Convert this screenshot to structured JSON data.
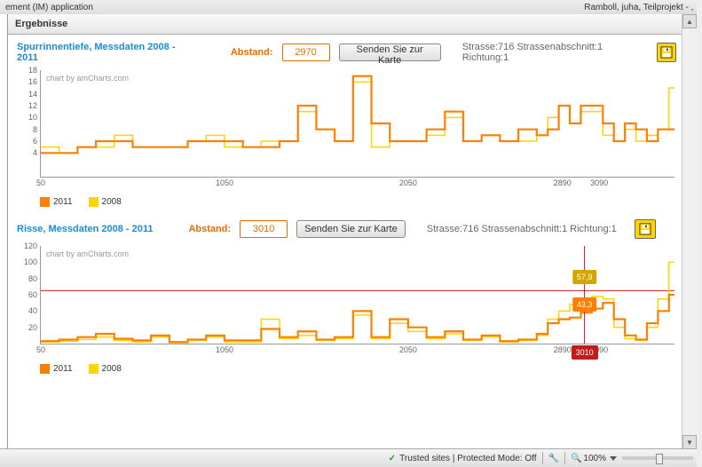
{
  "header": {
    "title_left": "ement (IM) application",
    "title_right": "Ramboll, juha, Teilprojekt - , ."
  },
  "results": {
    "heading": "Ergebnisse"
  },
  "charts": [
    {
      "title": "Spurrinnentiefe, Messdaten 2008 - 2011",
      "abstand_label": "Abstand:",
      "abstand_value": "2970",
      "send_label": "Senden Sie zur Karte",
      "meta": "Strasse:716 Strassenabschnitt:1 Richtung:1",
      "watermark": "chart by amCharts.com"
    },
    {
      "title": "Risse, Messdaten 2008 - 2011",
      "abstand_label": "Abstand:",
      "abstand_value": "3010",
      "send_label": "Senden Sie zur Karte",
      "meta": "Strasse:716 Strassenabschnitt:1 Richtung:1",
      "watermark": "chart by amCharts.com",
      "cursor": {
        "x": 3010,
        "label_axis": "3010",
        "label_2008": "57,9",
        "label_2011": "43,3"
      }
    }
  ],
  "legend": {
    "s1": "2011",
    "s2": "2008"
  },
  "status": {
    "trusted": "Trusted sites | Protected Mode: Off",
    "zoom": "100%"
  },
  "chart_data": [
    {
      "id": "spurrinnentiefe",
      "title": "Spurrinnentiefe, Messdaten 2008 - 2011",
      "type": "line-step",
      "xlabel": "",
      "ylabel": "",
      "ylim": [
        0,
        18
      ],
      "xlim": [
        50,
        3500
      ],
      "x_ticks": [
        50,
        1050,
        2050,
        2890,
        3090
      ],
      "y_ticks": [
        4,
        6,
        8,
        10,
        12,
        14,
        16,
        18
      ],
      "series": [
        {
          "name": "2011",
          "color": "#ff7f00",
          "x": [
            50,
            150,
            250,
            350,
            450,
            550,
            650,
            750,
            850,
            950,
            1050,
            1150,
            1250,
            1350,
            1450,
            1550,
            1650,
            1750,
            1850,
            1950,
            2050,
            2150,
            2250,
            2350,
            2450,
            2550,
            2650,
            2750,
            2810,
            2870,
            2930,
            2990,
            3050,
            3110,
            3170,
            3230,
            3290,
            3350,
            3410,
            3470
          ],
          "values": [
            4,
            4,
            5,
            6,
            6,
            5,
            5,
            5,
            6,
            6,
            6,
            5,
            5,
            6,
            12,
            8,
            6,
            17,
            9,
            6,
            6,
            8,
            11,
            6,
            7,
            6,
            8,
            7,
            8,
            12,
            9,
            12,
            12,
            9,
            6,
            9,
            8,
            6,
            8,
            8
          ]
        },
        {
          "name": "2008",
          "color": "#ffd400",
          "x": [
            50,
            150,
            250,
            350,
            450,
            550,
            650,
            750,
            850,
            950,
            1050,
            1150,
            1250,
            1350,
            1450,
            1550,
            1650,
            1750,
            1850,
            1950,
            2050,
            2150,
            2250,
            2350,
            2450,
            2550,
            2650,
            2750,
            2810,
            2870,
            2930,
            2990,
            3050,
            3110,
            3170,
            3230,
            3290,
            3350,
            3410,
            3470
          ],
          "values": [
            5,
            4,
            5,
            5,
            7,
            5,
            5,
            5,
            6,
            7,
            5,
            5,
            6,
            6,
            11,
            8,
            6,
            16,
            5,
            6,
            6,
            7,
            10,
            6,
            7,
            6,
            6,
            7,
            10,
            12,
            9,
            11,
            11,
            7,
            6,
            8,
            6,
            7,
            8,
            15
          ]
        }
      ]
    },
    {
      "id": "risse",
      "title": "Risse, Messdaten 2008 - 2011",
      "type": "line-step",
      "xlabel": "",
      "ylabel": "",
      "ylim": [
        0,
        120
      ],
      "xlim": [
        50,
        3500
      ],
      "threshold": 65,
      "x_ticks": [
        50,
        1050,
        2050,
        2890,
        3090
      ],
      "y_ticks": [
        20,
        40,
        60,
        80,
        100,
        120
      ],
      "series": [
        {
          "name": "2011",
          "color": "#ff7f00",
          "x": [
            50,
            150,
            250,
            350,
            450,
            550,
            650,
            750,
            850,
            950,
            1050,
            1150,
            1250,
            1350,
            1450,
            1550,
            1650,
            1750,
            1850,
            1950,
            2050,
            2150,
            2250,
            2350,
            2450,
            2550,
            2650,
            2750,
            2810,
            2870,
            2930,
            2990,
            3050,
            3110,
            3170,
            3230,
            3290,
            3350,
            3410,
            3470
          ],
          "values": [
            3,
            5,
            8,
            12,
            6,
            4,
            10,
            2,
            5,
            10,
            4,
            4,
            18,
            8,
            15,
            5,
            8,
            40,
            8,
            30,
            20,
            8,
            15,
            5,
            10,
            3,
            5,
            12,
            25,
            30,
            32,
            38,
            43,
            50,
            30,
            10,
            5,
            25,
            40,
            60
          ]
        },
        {
          "name": "2008",
          "color": "#ffd400",
          "x": [
            50,
            150,
            250,
            350,
            450,
            550,
            650,
            750,
            850,
            950,
            1050,
            1150,
            1250,
            1350,
            1450,
            1550,
            1650,
            1750,
            1850,
            1950,
            2050,
            2150,
            2250,
            2350,
            2450,
            2550,
            2650,
            2750,
            2810,
            2870,
            2930,
            2990,
            3050,
            3110,
            3170,
            3230,
            3290,
            3350,
            3410,
            3470
          ],
          "values": [
            2,
            3,
            5,
            8,
            4,
            2,
            8,
            1,
            4,
            8,
            2,
            2,
            30,
            6,
            10,
            4,
            6,
            35,
            6,
            25,
            15,
            6,
            12,
            4,
            8,
            2,
            4,
            10,
            30,
            40,
            48,
            55,
            58,
            55,
            20,
            6,
            4,
            20,
            55,
            100
          ]
        }
      ]
    }
  ]
}
